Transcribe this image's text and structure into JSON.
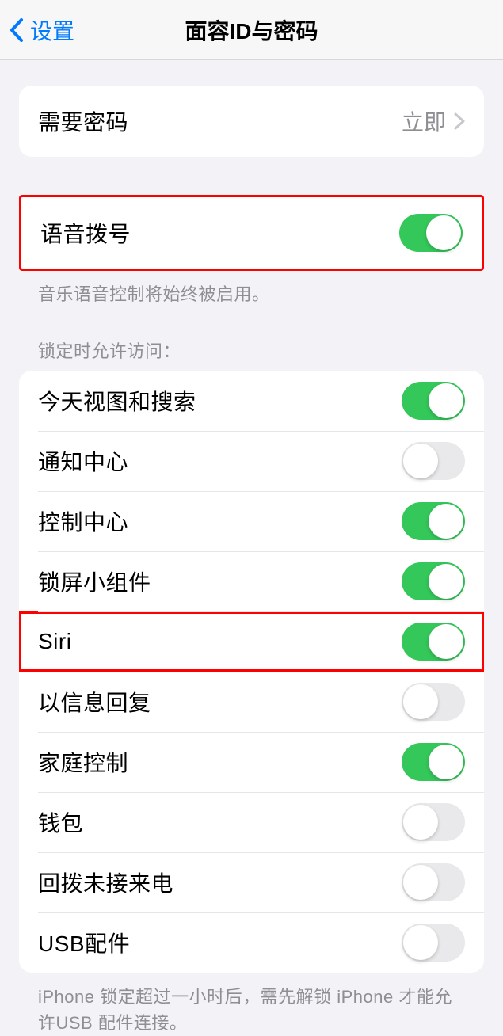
{
  "nav": {
    "back_label": "设置",
    "title": "面容ID与密码"
  },
  "require_passcode": {
    "label": "需要密码",
    "value": "立即"
  },
  "voice_dial": {
    "label": "语音拨号",
    "on": true,
    "footer": "音乐语音控制将始终被启用。"
  },
  "lock_access": {
    "header": "锁定时允许访问：",
    "items": [
      {
        "label": "今天视图和搜索",
        "on": true
      },
      {
        "label": "通知中心",
        "on": false
      },
      {
        "label": "控制中心",
        "on": true
      },
      {
        "label": "锁屏小组件",
        "on": true
      },
      {
        "label": "Siri",
        "on": true
      },
      {
        "label": "以信息回复",
        "on": false
      },
      {
        "label": "家庭控制",
        "on": true
      },
      {
        "label": "钱包",
        "on": false
      },
      {
        "label": "回拨未接来电",
        "on": false
      },
      {
        "label": "USB配件",
        "on": false
      }
    ],
    "footer": "iPhone 锁定超过一小时后，需先解锁 iPhone 才能允许USB 配件连接。"
  }
}
